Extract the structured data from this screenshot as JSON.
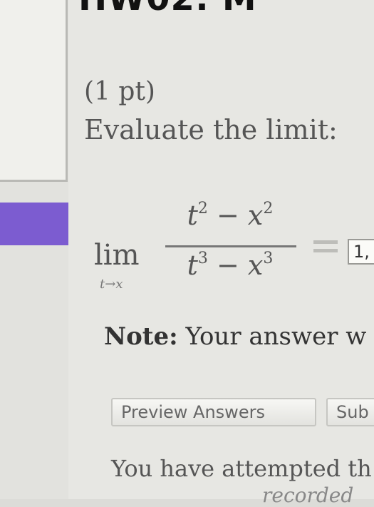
{
  "header": {
    "title_fragment": "HW02: M"
  },
  "problem": {
    "points": "(1 pt)",
    "prompt": "Evaluate the limit:",
    "limit": {
      "lim": "lim",
      "subscript": "t→x",
      "numerator_a": "t",
      "numerator_a_exp": "2",
      "numerator_op": " − ",
      "numerator_b": "x",
      "numerator_b_exp": "2",
      "denominator_a": "t",
      "denominator_a_exp": "3",
      "denominator_op": " − ",
      "denominator_b": "x",
      "denominator_b_exp": "3"
    },
    "answer_value": "1,"
  },
  "note": {
    "label": "Note:",
    "text": " Your answer w"
  },
  "buttons": {
    "preview": "Preview Answers",
    "submit": "Sub"
  },
  "footer": {
    "attempts_text": "You have attempted th",
    "recorded_text": "recorded"
  },
  "colors": {
    "nav_active": "#7c5cd0"
  }
}
